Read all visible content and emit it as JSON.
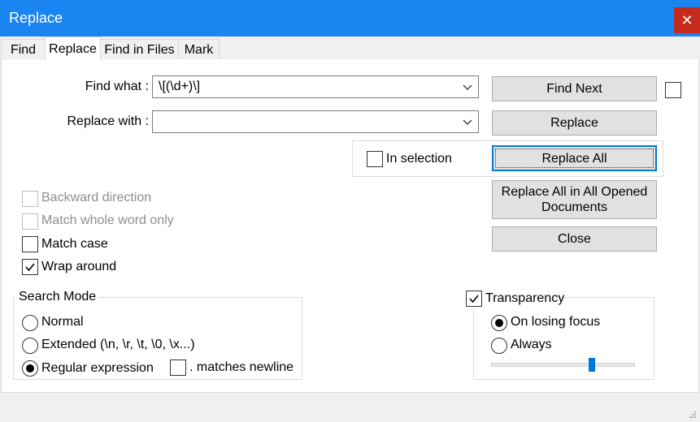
{
  "window": {
    "title": "Replace"
  },
  "tabs": [
    {
      "label": "Find"
    },
    {
      "label": "Replace"
    },
    {
      "label": "Find in Files"
    },
    {
      "label": "Mark"
    }
  ],
  "find": {
    "label": "Find what :",
    "value": "\\[(\\d+)\\]"
  },
  "replace": {
    "label": "Replace with :",
    "value": ""
  },
  "buttons": {
    "find_next": "Find Next",
    "replace": "Replace",
    "replace_all": "Replace All",
    "replace_all_opened_line1": "Replace All in All Opened",
    "replace_all_opened_line2": "Documents",
    "close": "Close"
  },
  "in_selection": {
    "label": "In selection",
    "checked": false
  },
  "options": {
    "backward_direction": {
      "label": "Backward direction",
      "checked": false,
      "enabled": false
    },
    "match_whole_word": {
      "label": "Match whole word only",
      "checked": false,
      "enabled": false
    },
    "match_case": {
      "label": "Match case",
      "checked": false,
      "enabled": true
    },
    "wrap_around": {
      "label": "Wrap around",
      "checked": true,
      "enabled": true
    }
  },
  "search_mode": {
    "title": "Search Mode",
    "normal": "Normal",
    "extended": "Extended (\\n, \\r, \\t, \\0, \\x...)",
    "regex": "Regular expression",
    "matches_newline": ". matches newline",
    "selected": "regex"
  },
  "transparency": {
    "label": "Transparency",
    "checked": true,
    "on_losing_focus": "On losing focus",
    "always": "Always",
    "selected": "on_losing_focus",
    "level": 0.71
  },
  "colors": {
    "titlebar": "#1a85f0",
    "close": "#c42b1c",
    "accent": "#0078d7"
  }
}
